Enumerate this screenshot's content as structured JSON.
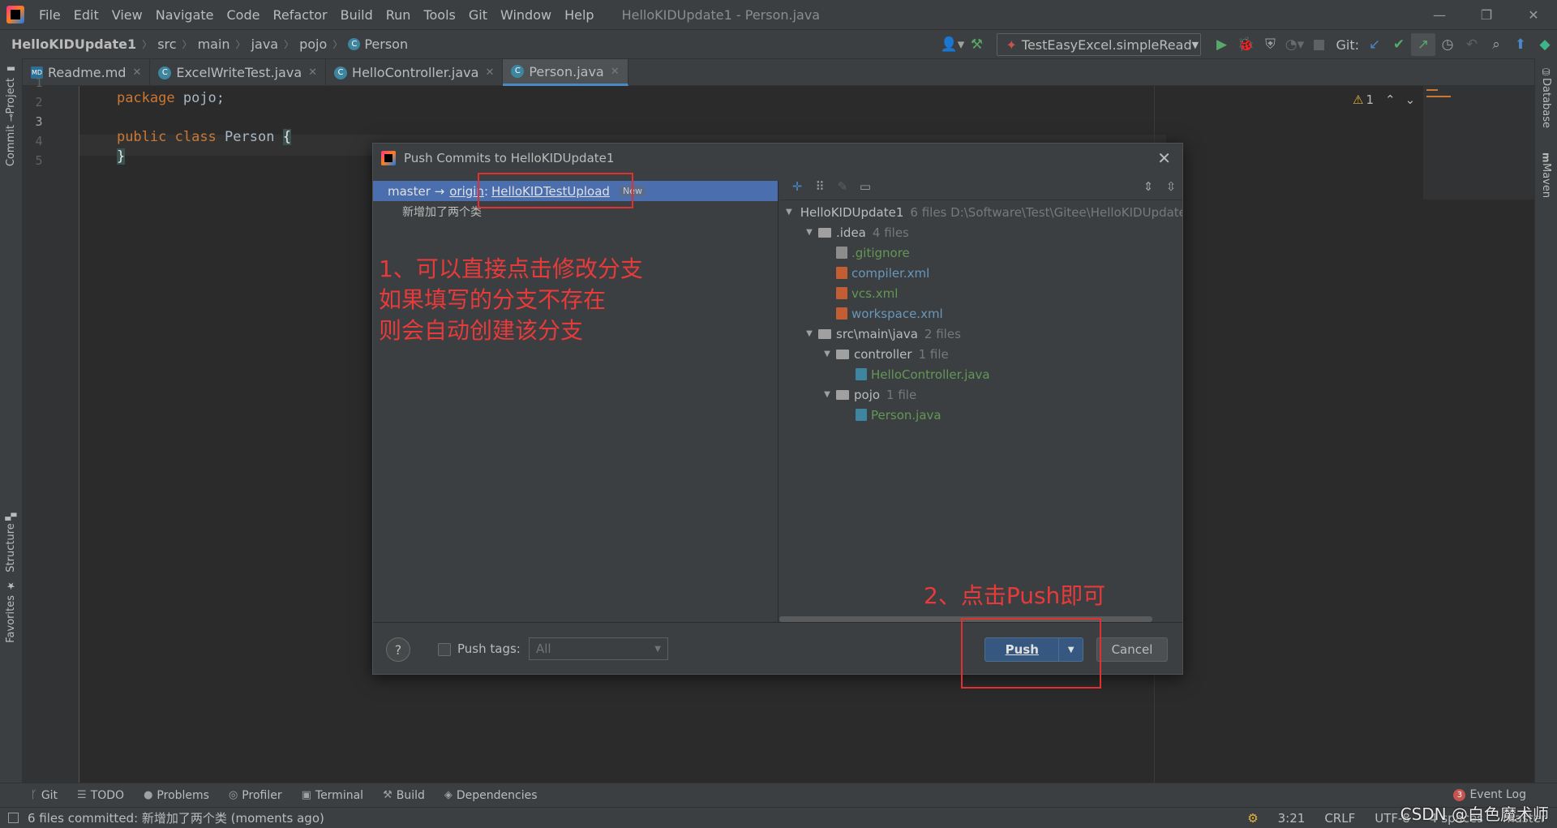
{
  "menubar": {
    "items": [
      "File",
      "Edit",
      "View",
      "Navigate",
      "Code",
      "Refactor",
      "Build",
      "Run",
      "Tools",
      "Git",
      "Window",
      "Help"
    ],
    "window_title": "HelloKIDUpdate1 - Person.java",
    "minimize": "—",
    "restore": "❐",
    "close": "✕"
  },
  "navbar": {
    "crumbs": [
      "HelloKIDUpdate1",
      "src",
      "main",
      "java",
      "pojo",
      "Person"
    ],
    "run_config": "TestEasyExcel.simpleRead",
    "git_label": "Git:"
  },
  "tabs": [
    {
      "label": "Readme.md",
      "icon": "markdown-file-icon",
      "active": false
    },
    {
      "label": "ExcelWriteTest.java",
      "icon": "java-class-icon",
      "active": false
    },
    {
      "label": "HelloController.java",
      "icon": "java-class-icon",
      "active": false
    },
    {
      "label": "Person.java",
      "icon": "java-class-icon",
      "active": true
    }
  ],
  "left_stripe": {
    "project": "Project",
    "commit": "Commit",
    "structure": "Structure",
    "favorites": "Favorites"
  },
  "right_stripe": {
    "database": "Database",
    "maven": "Maven"
  },
  "editor": {
    "line_numbers": [
      "1",
      "2",
      "3",
      "4",
      "5"
    ],
    "line1_kw": "package",
    "line1_rest": " pojo;",
    "line3_kw1": "public",
    "line3_kw2": " class",
    "line3_cls": " Person ",
    "line3_brace": "{",
    "line4_brace": "}",
    "warning_count": "1"
  },
  "dialog": {
    "title": "Push Commits to HelloKIDUpdate1",
    "commit_source": "master → ",
    "remote": "origin",
    "colon": " : ",
    "target_branch": "HelloKIDTestUpload",
    "new_badge": "New",
    "commit_message": "新增加了两个类",
    "tree": {
      "root": "HelloKIDUpdate1",
      "root_meta": "6 files  D:\\Software\\Test\\Gitee\\HelloKIDUpdate1",
      "idea": ".idea",
      "idea_meta": "4 files",
      "f1": ".gitignore",
      "f2": "compiler.xml",
      "f3": "vcs.xml",
      "f4": "workspace.xml",
      "src": "src\\main\\java",
      "src_meta": "2 files",
      "controller": "controller",
      "controller_meta": "1 file",
      "f5": "HelloController.java",
      "pojo": "pojo",
      "pojo_meta": "1 file",
      "f6": "Person.java"
    },
    "push_tags_label": "Push tags:",
    "tags_value": "All",
    "help": "?",
    "push_label": "Push",
    "cancel_label": "Cancel"
  },
  "annotations": {
    "note1_line1": "1、可以直接点击修改分支",
    "note1_line2": "如果填写的分支不存在",
    "note1_line3": "则会自动创建该分支",
    "note2": "2、点击Push即可"
  },
  "bottom_tools": [
    "Git",
    "TODO",
    "Problems",
    "Profiler",
    "Terminal",
    "Build",
    "Dependencies"
  ],
  "event_log": {
    "count": "3",
    "label": "Event Log"
  },
  "statusbar": {
    "message": "6 files committed: 新增加了两个类 (moments ago)",
    "position": "3:21",
    "line_sep": "CRLF",
    "encoding": "UTF-8",
    "indent": "4 spaces",
    "branch": "master"
  },
  "watermark": "CSDN @白色魔术师",
  "colors": {
    "accent": "#4a88c7",
    "selection": "#4b6eaf",
    "annotation": "#e03030",
    "push_button": "#365880"
  }
}
